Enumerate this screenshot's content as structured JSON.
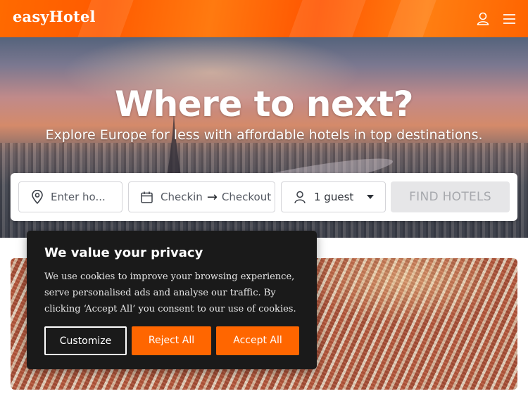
{
  "header": {
    "logo": "easyHotel",
    "brand_color": "#ff6600",
    "icons": [
      "user-icon",
      "menu-icon"
    ]
  },
  "hero": {
    "title": "Where to next?",
    "subtitle": "Explore Europe for less with affordable hotels in top destinations."
  },
  "search": {
    "destination_placeholder": "Enter ho...",
    "checkin_label": "Checkin",
    "arrow": "→",
    "checkout_label": "Checkout",
    "guests_value": "1 guest",
    "find_button": "FIND HOTELS",
    "icons": [
      "location-pin-icon",
      "calendar-icon",
      "user-icon",
      "caret-down-icon"
    ]
  },
  "cookie_banner": {
    "title": "We value your privacy",
    "text": "We use cookies to improve your browsing experience, serve personalised ads and analyse our traffic. By clicking ‘Accept All’ you consent to our use of cookies.",
    "customize_label": "Customize",
    "reject_label": "Reject All",
    "accept_label": "Accept All",
    "button_color": "#ff6600",
    "background_color": "#1a1a1a"
  }
}
